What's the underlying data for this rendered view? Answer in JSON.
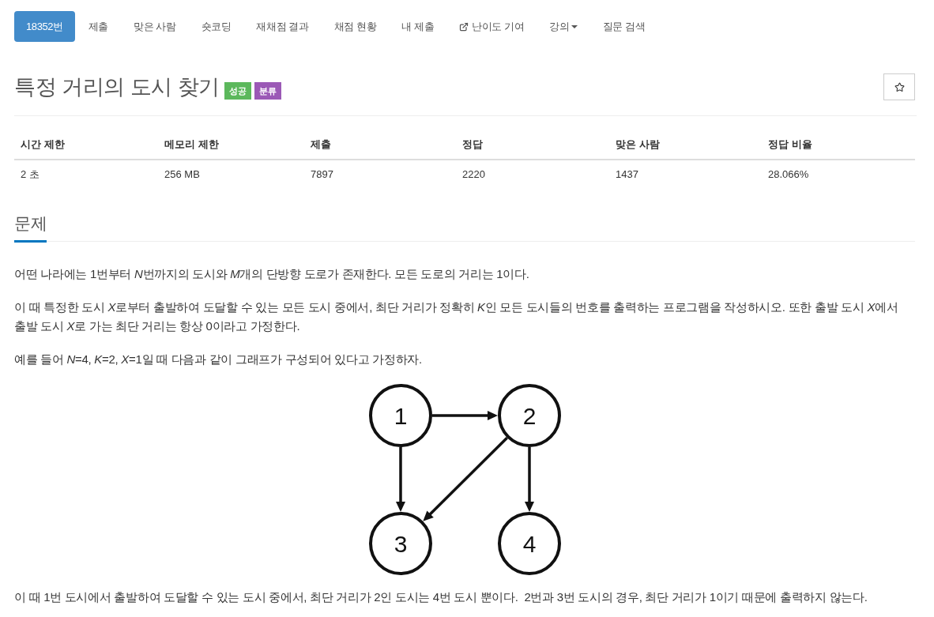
{
  "nav_tabs": [
    {
      "label": "18352번",
      "kind": "plain",
      "selected": true
    },
    {
      "label": "제출",
      "kind": "plain",
      "selected": false
    },
    {
      "label": "맞은 사람",
      "kind": "plain",
      "selected": false
    },
    {
      "label": "숏코딩",
      "kind": "plain",
      "selected": false
    },
    {
      "label": "재채점 결과",
      "kind": "plain",
      "selected": false
    },
    {
      "label": "채점 현황",
      "kind": "plain",
      "selected": false
    },
    {
      "label": "내 제출",
      "kind": "plain",
      "selected": false
    },
    {
      "label": "난이도 기여",
      "kind": "external",
      "selected": false
    },
    {
      "label": "강의",
      "kind": "dropdown",
      "selected": false
    },
    {
      "label": "질문 검색",
      "kind": "plain",
      "selected": false
    }
  ],
  "title": "특정 거리의 도시 찾기",
  "title_badges": [
    {
      "label": "성공",
      "color": "#5cb85c"
    },
    {
      "label": "분류",
      "color": "#9b59b6"
    }
  ],
  "info_table": {
    "columns": [
      "시간 제한",
      "메모리 제한",
      "제출",
      "정답",
      "맞은 사람",
      "정답 비율"
    ],
    "rows": [
      [
        "2 초",
        "256 MB",
        "7897",
        "2220",
        "1437",
        "28.066%"
      ]
    ]
  },
  "problem": {
    "heading": "문제",
    "body": [
      {
        "kind": "paragraph",
        "segments": [
          {
            "text": "어떤 나라에는 1번부터 ",
            "italic": false
          },
          {
            "text": "N",
            "italic": true
          },
          {
            "text": "번까지의 도시와 ",
            "italic": false
          },
          {
            "text": "M",
            "italic": true
          },
          {
            "text": "개의 단방향 도로가 존재한다. 모든 도로의 거리는 1이다.",
            "italic": false
          }
        ]
      },
      {
        "kind": "paragraph",
        "segments": [
          {
            "text": "이 때 특정한 도시 ",
            "italic": false
          },
          {
            "text": "X",
            "italic": true
          },
          {
            "text": "로부터 출발하여 도달할 수 있는 모든 도시 중에서, 최단 거리가 정확히 ",
            "italic": false
          },
          {
            "text": "K",
            "italic": true
          },
          {
            "text": "인 모든 도시들의 번호를 출력하는 프로그램을 작성하시오. 또한 출발 도시 ",
            "italic": false
          },
          {
            "text": "X",
            "italic": true
          },
          {
            "text": "에서 출발 도시 ",
            "italic": false
          },
          {
            "text": "X",
            "italic": true
          },
          {
            "text": "로 가는 최단 거리는 항상 0이라고 가정한다.",
            "italic": false
          }
        ]
      },
      {
        "kind": "paragraph",
        "segments": [
          {
            "text": "예를 들어 ",
            "italic": false
          },
          {
            "text": "N",
            "italic": true
          },
          {
            "text": "=4, ",
            "italic": false
          },
          {
            "text": "K",
            "italic": true
          },
          {
            "text": "=2, ",
            "italic": false
          },
          {
            "text": "X",
            "italic": true
          },
          {
            "text": "=1일 때 다음과 같이 그래프가 구성되어 있다고 가정하자.",
            "italic": false
          }
        ]
      },
      {
        "kind": "graph",
        "nodes": [
          {
            "label": "1"
          },
          {
            "label": "2"
          },
          {
            "label": "3"
          },
          {
            "label": "4"
          }
        ]
      },
      {
        "kind": "paragraph",
        "segments": [
          {
            "text": "이 때 1번 도시에서 출발하여 도달할 수 있는 도시 중에서, 최단 거리가 2인 도시는 4번 도시 뿐이다.  2번과 3번 도시의 경우, 최단 거리가 1이기 때문에 출력하지 않는다.",
            "italic": false
          }
        ]
      }
    ]
  }
}
